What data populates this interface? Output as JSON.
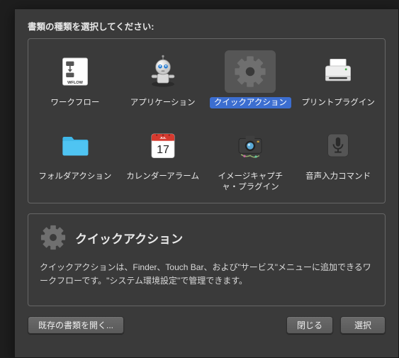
{
  "prompt": "書類の種類を選択してください:",
  "types": [
    {
      "id": "workflow",
      "label": "ワークフロー",
      "icon": "workflow-icon",
      "selected": false
    },
    {
      "id": "app",
      "label": "アプリケーション",
      "icon": "robot-icon",
      "selected": false
    },
    {
      "id": "quick",
      "label": "クイックアクション",
      "icon": "gear-icon",
      "selected": true
    },
    {
      "id": "print",
      "label": "プリントプラグイン",
      "icon": "printer-icon",
      "selected": false
    },
    {
      "id": "folder",
      "label": "フォルダアクション",
      "icon": "folder-icon",
      "selected": false
    },
    {
      "id": "calendar",
      "label": "カレンダーアラーム",
      "icon": "calendar-icon",
      "selected": false,
      "calendar_day": "17",
      "calendar_month": "JUL"
    },
    {
      "id": "image",
      "label": "イメージキャプチ\nャ・プラグイン",
      "icon": "camera-icon",
      "selected": false
    },
    {
      "id": "dictation",
      "label": "音声入力コマンド",
      "icon": "mic-icon",
      "selected": false
    }
  ],
  "description": {
    "title": "クイックアクション",
    "text": "クイックアクションは、Finder、Touch Bar、および\"サービス\"メニューに追加できるワークフローです。\"システム環境設定\"で管理できます。",
    "icon": "gear-icon"
  },
  "buttons": {
    "open_existing": "既存の書類を開く...",
    "close": "閉じる",
    "choose": "選択"
  }
}
